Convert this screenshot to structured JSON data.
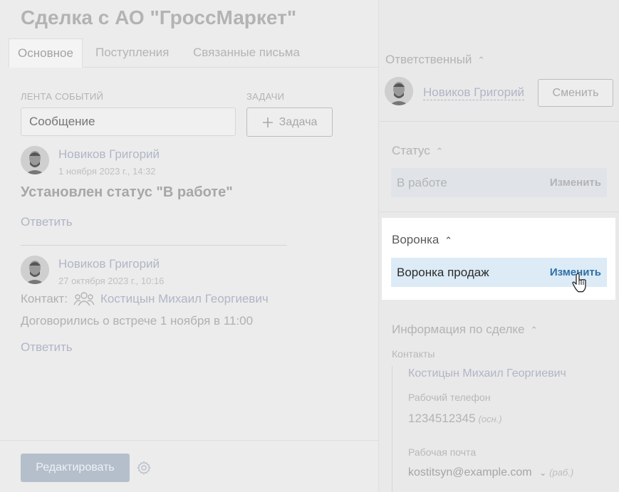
{
  "header": {
    "title": "Сделка с АО \"ГроссМаркет\"",
    "icons": [
      "exit-icon",
      "lock-icon",
      "expand-icon",
      "close-icon"
    ]
  },
  "tabs": [
    {
      "label": "Основное",
      "active": true
    },
    {
      "label": "Поступления",
      "active": false
    },
    {
      "label": "Связанные письма",
      "active": false
    }
  ],
  "feed": {
    "section_label": "ЛЕНТА СОБЫТИЙ",
    "message_placeholder": "Сообщение",
    "tasks_label": "ЗАДАЧИ",
    "task_button": "Задача",
    "events": [
      {
        "author": "Новиков Григорий",
        "date": "1 ноября 2023 г., 14:32",
        "text": "Установлен статус \"В работе\"",
        "reply": "Ответить"
      },
      {
        "author": "Новиков Григорий",
        "date": "27 октября 2023 г., 10:16",
        "contact_label": "Контакт:",
        "contact_name": "Костицын Михаил Георгиевич",
        "text": "Договорились о встрече 1 ноября в 11:00",
        "reply": "Ответить"
      }
    ]
  },
  "footer": {
    "edit_button": "Редактировать"
  },
  "sidebar": {
    "responsible": {
      "title": "Ответственный",
      "name": "Новиков Григорий",
      "change_button": "Сменить"
    },
    "status": {
      "title": "Статус",
      "value": "В работе",
      "action": "Изменить"
    },
    "funnel": {
      "title": "Воронка",
      "value": "Воронка продаж",
      "action": "Изменить"
    },
    "deal_info": {
      "title": "Информация по сделке",
      "contacts_label": "Контакты",
      "contact_name": "Костицын Михаил Георгиевич",
      "phone_label": "Рабочий телефон",
      "phone": "1234512345",
      "phone_hint": "(осн.)",
      "email_label": "Рабочая почта",
      "email": "kostitsyn@example.com",
      "email_hint": "(раб.)"
    }
  }
}
